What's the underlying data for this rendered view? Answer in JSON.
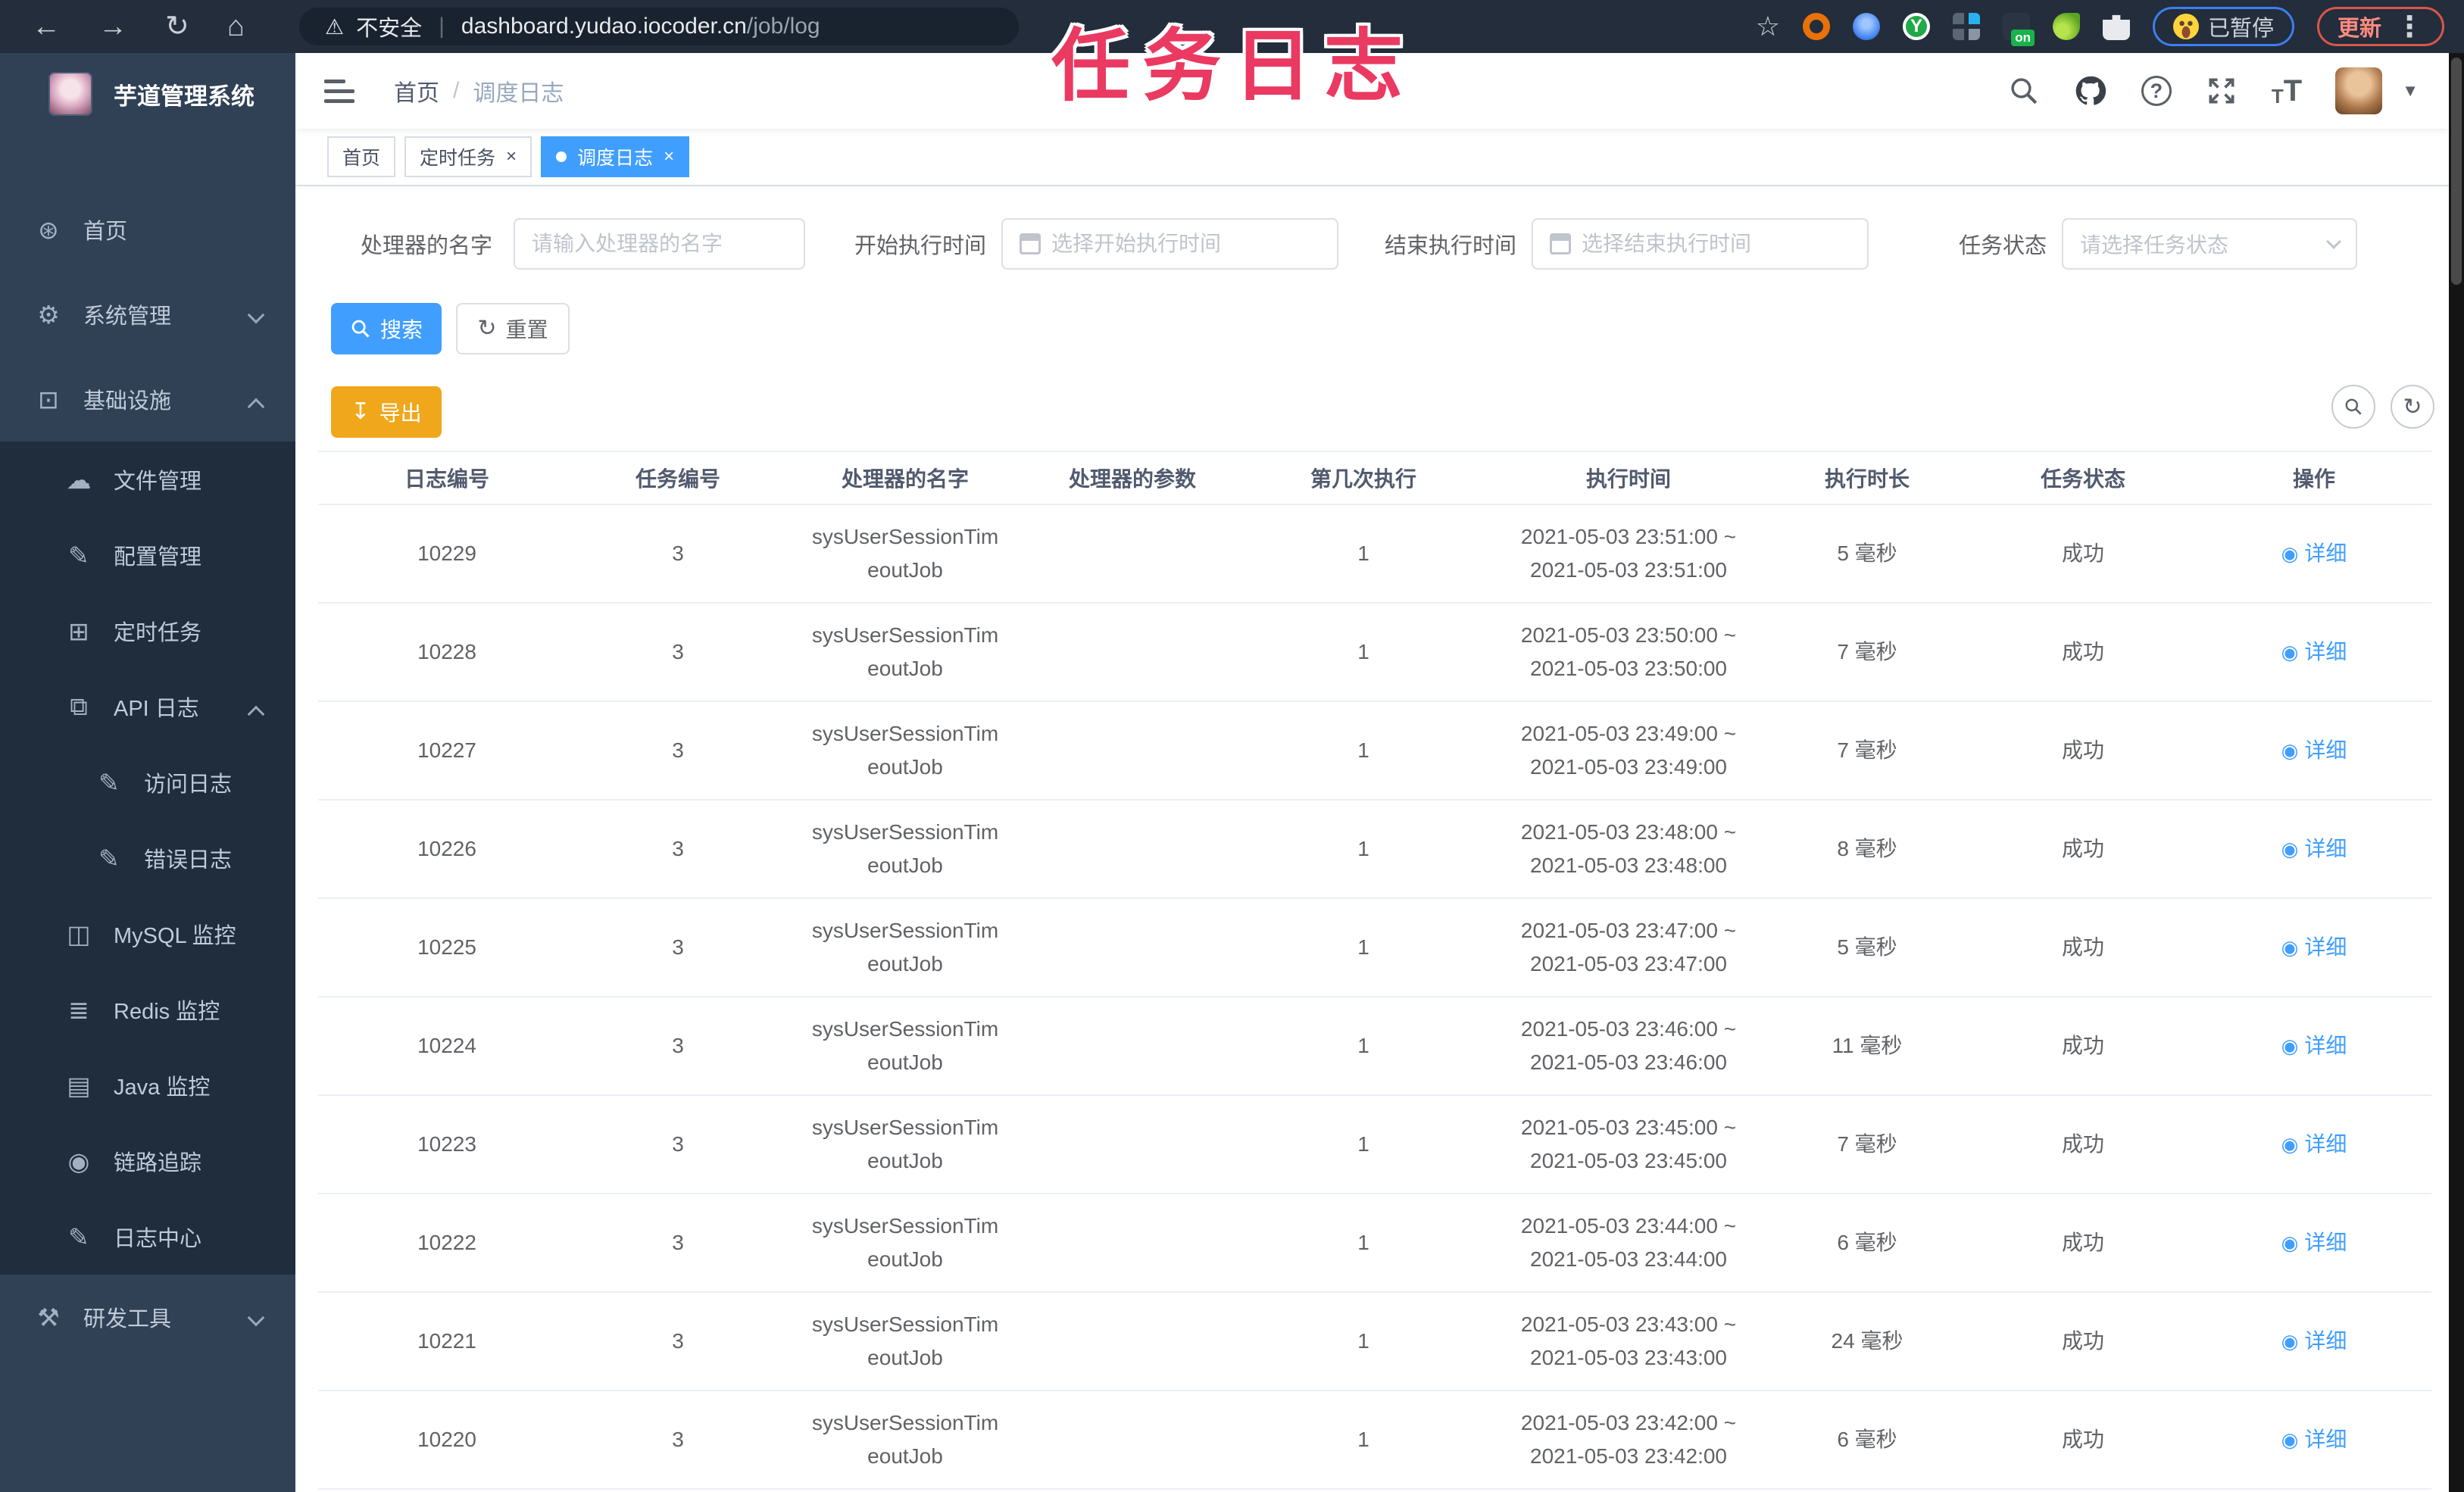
{
  "browser": {
    "secure_label": "不安全",
    "url_host": "dashboard.yudao.iocoder.cn",
    "url_path": "/job/log",
    "on_badge": "on",
    "paused_badge": "已暂停",
    "update_button": "更新"
  },
  "annotation_title": "任务日志",
  "sidebar": {
    "app_title": "芋道管理系统",
    "items": [
      {
        "label": "首页",
        "icon": "dashboard-icon",
        "glyph": "⊛",
        "level": 1,
        "section": "main",
        "arrow": null
      },
      {
        "label": "系统管理",
        "icon": "gear-icon",
        "glyph": "⚙",
        "level": 1,
        "section": "main",
        "arrow": "down"
      },
      {
        "label": "基础设施",
        "icon": "infrastructure-icon",
        "glyph": "⊡",
        "level": 1,
        "section": "main",
        "arrow": "up"
      },
      {
        "label": "文件管理",
        "icon": "file-upload-icon",
        "glyph": "☁",
        "level": 2,
        "section": "sub",
        "arrow": null
      },
      {
        "label": "配置管理",
        "icon": "config-edit-icon",
        "glyph": "✎",
        "level": 2,
        "section": "sub",
        "arrow": null
      },
      {
        "label": "定时任务",
        "icon": "timed-task-icon",
        "glyph": "⊞",
        "level": 2,
        "section": "sub",
        "arrow": null
      },
      {
        "label": "API 日志",
        "icon": "api-log-icon",
        "glyph": "⧉",
        "level": 2,
        "section": "sub",
        "arrow": "up"
      },
      {
        "label": "访问日志",
        "icon": "access-log-icon",
        "glyph": "✎",
        "level": 3,
        "section": "sub",
        "arrow": null
      },
      {
        "label": "错误日志",
        "icon": "error-log-icon",
        "glyph": "✎",
        "level": 3,
        "section": "sub",
        "arrow": null
      },
      {
        "label": "MySQL 监控",
        "icon": "mysql-monitor-icon",
        "glyph": "◫",
        "level": 2,
        "section": "sub",
        "arrow": null
      },
      {
        "label": "Redis 监控",
        "icon": "redis-monitor-icon",
        "glyph": "≣",
        "level": 2,
        "section": "sub",
        "arrow": null
      },
      {
        "label": "Java 监控",
        "icon": "java-monitor-icon",
        "glyph": "▤",
        "level": 2,
        "section": "sub",
        "arrow": null
      },
      {
        "label": "链路追踪",
        "icon": "trace-eye-icon",
        "glyph": "◉",
        "level": 2,
        "section": "sub",
        "arrow": null
      },
      {
        "label": "日志中心",
        "icon": "log-center-icon",
        "glyph": "✎",
        "level": 2,
        "section": "sub",
        "arrow": null
      },
      {
        "label": "研发工具",
        "icon": "dev-tools-icon",
        "glyph": "⚒",
        "level": 1,
        "section": "main",
        "arrow": "down"
      }
    ]
  },
  "header": {
    "breadcrumb_home": "首页",
    "breadcrumb_separator": "/",
    "breadcrumb_current": "调度日志"
  },
  "tabs": [
    {
      "label": "首页",
      "active": false,
      "closable": false
    },
    {
      "label": "定时任务",
      "active": false,
      "closable": true
    },
    {
      "label": "调度日志",
      "active": true,
      "closable": true
    }
  ],
  "filters": {
    "handler": {
      "label": "处理器的名字",
      "placeholder": "请输入处理器的名字"
    },
    "start_time": {
      "label": "开始执行时间",
      "placeholder": "选择开始执行时间"
    },
    "end_time": {
      "label": "结束执行时间",
      "placeholder": "选择结束执行时间"
    },
    "status": {
      "label": "任务状态",
      "placeholder": "请选择任务状态"
    }
  },
  "actions": {
    "search": "搜索",
    "reset": "重置",
    "export": "导出"
  },
  "table": {
    "columns": [
      "日志编号",
      "任务编号",
      "处理器的名字",
      "处理器的参数",
      "第几次执行",
      "执行时间",
      "执行时长",
      "任务状态",
      "操作"
    ],
    "action_label": "详细",
    "rows": [
      {
        "log_id": "10229",
        "task_id": "3",
        "handler_line1": "sysUserSessionTim",
        "handler_line2": "eoutJob",
        "param": "",
        "exec_index": "1",
        "time_start": "2021-05-03 23:51:00 ~",
        "time_end": "2021-05-03 23:51:00",
        "duration": "5 毫秒",
        "status": "成功",
        "action": "详细"
      },
      {
        "log_id": "10228",
        "task_id": "3",
        "handler_line1": "sysUserSessionTim",
        "handler_line2": "eoutJob",
        "param": "",
        "exec_index": "1",
        "time_start": "2021-05-03 23:50:00 ~",
        "time_end": "2021-05-03 23:50:00",
        "duration": "7 毫秒",
        "status": "成功",
        "action": "详细"
      },
      {
        "log_id": "10227",
        "task_id": "3",
        "handler_line1": "sysUserSessionTim",
        "handler_line2": "eoutJob",
        "param": "",
        "exec_index": "1",
        "time_start": "2021-05-03 23:49:00 ~",
        "time_end": "2021-05-03 23:49:00",
        "duration": "7 毫秒",
        "status": "成功",
        "action": "详细"
      },
      {
        "log_id": "10226",
        "task_id": "3",
        "handler_line1": "sysUserSessionTim",
        "handler_line2": "eoutJob",
        "param": "",
        "exec_index": "1",
        "time_start": "2021-05-03 23:48:00 ~",
        "time_end": "2021-05-03 23:48:00",
        "duration": "8 毫秒",
        "status": "成功",
        "action": "详细"
      },
      {
        "log_id": "10225",
        "task_id": "3",
        "handler_line1": "sysUserSessionTim",
        "handler_line2": "eoutJob",
        "param": "",
        "exec_index": "1",
        "time_start": "2021-05-03 23:47:00 ~",
        "time_end": "2021-05-03 23:47:00",
        "duration": "5 毫秒",
        "status": "成功",
        "action": "详细"
      },
      {
        "log_id": "10224",
        "task_id": "3",
        "handler_line1": "sysUserSessionTim",
        "handler_line2": "eoutJob",
        "param": "",
        "exec_index": "1",
        "time_start": "2021-05-03 23:46:00 ~",
        "time_end": "2021-05-03 23:46:00",
        "duration": "11 毫秒",
        "status": "成功",
        "action": "详细"
      },
      {
        "log_id": "10223",
        "task_id": "3",
        "handler_line1": "sysUserSessionTim",
        "handler_line2": "eoutJob",
        "param": "",
        "exec_index": "1",
        "time_start": "2021-05-03 23:45:00 ~",
        "time_end": "2021-05-03 23:45:00",
        "duration": "7 毫秒",
        "status": "成功",
        "action": "详细"
      },
      {
        "log_id": "10222",
        "task_id": "3",
        "handler_line1": "sysUserSessionTim",
        "handler_line2": "eoutJob",
        "param": "",
        "exec_index": "1",
        "time_start": "2021-05-03 23:44:00 ~",
        "time_end": "2021-05-03 23:44:00",
        "duration": "6 毫秒",
        "status": "成功",
        "action": "详细"
      },
      {
        "log_id": "10221",
        "task_id": "3",
        "handler_line1": "sysUserSessionTim",
        "handler_line2": "eoutJob",
        "param": "",
        "exec_index": "1",
        "time_start": "2021-05-03 23:43:00 ~",
        "time_end": "2021-05-03 23:43:00",
        "duration": "24 毫秒",
        "status": "成功",
        "action": "详细"
      },
      {
        "log_id": "10220",
        "task_id": "3",
        "handler_line1": "sysUserSessionTim",
        "handler_line2": "eoutJob",
        "param": "",
        "exec_index": "1",
        "time_start": "2021-05-03 23:42:00 ~",
        "time_end": "2021-05-03 23:42:00",
        "duration": "6 毫秒",
        "status": "成功",
        "action": "详细"
      }
    ]
  },
  "colors": {
    "accent": "#409eff",
    "warning": "#f0a71c",
    "annotation": "#ea3a62",
    "sidebar_bg": "#304156",
    "submenu_bg": "#1f2d3d"
  }
}
